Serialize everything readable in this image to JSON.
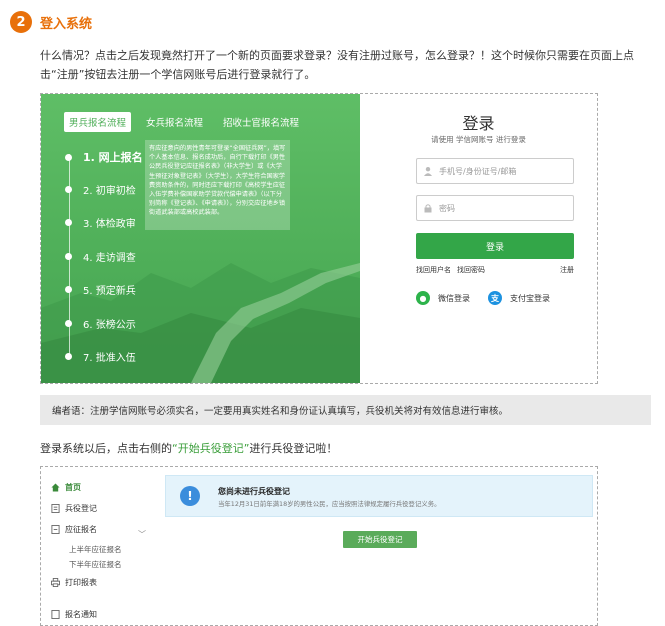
{
  "section": {
    "number": "2",
    "title": "登入系统"
  },
  "intro_text": "什么情况？点击之后发现竟然打开了一个新的页面要求登录？没有注册过账号，怎么登录？！这个时候你只需要在页面上点击“注册”按钮去注册一个学信网账号后进行登录就行了。",
  "screenshot1": {
    "tabs": [
      "男兵报名流程",
      "女兵报名流程",
      "招收士官报名流程"
    ],
    "steps": [
      "1. 网上报名",
      "2. 初审初检",
      "3. 体检政审",
      "4. 走访调查",
      "5. 预定新兵",
      "6. 张榜公示",
      "7. 批准入伍"
    ],
    "info_text": "有应征意向的男性青年可登录“全国征兵网”，填写个人基本信息、报名成功后，自行下载打印《男性公民兵役登记应征报名表》（非大学生）或《大学生预征对象登记表》（大学生），大学生符合国家学费资助条件的，同时还应下载打印《高校学生应征入伍学费补偿国家助学贷款代偿申请表》（以下分别简称《登记表》、《申请表》），分别交应征地乡镇街道武装部或高校武装部。",
    "login": {
      "title": "登录",
      "subtitle": "请使用 学信网账号 进行登录",
      "username_placeholder": "手机号/身份证号/邮箱",
      "password_placeholder": "密码",
      "login_button": "登录",
      "forgot_username": "找回用户名",
      "forgot_password": "找回密码",
      "register": "注册",
      "wechat_login": "微信登录",
      "alipay_login": "支付宝登录"
    }
  },
  "editor_note": "编者语：注册学信网账号必须实名，一定要用真实姓名和身份证认真填写，兵役机关将对有效信息进行审核。",
  "after_text": {
    "before": "登录系统以后，点击右侧的",
    "highlight": "“开始兵役登记”",
    "after": "进行兵役登记啦！"
  },
  "screenshot2": {
    "sidebar": {
      "home": "首页",
      "bingyi_register": "兵役登记",
      "enlist_apply": "应征报名",
      "first_half": "上半年应征报名",
      "second_half": "下半年应征报名",
      "print_report": "打印报表",
      "enlist_notice": "报名通知"
    },
    "alert_title": "您尚未进行兵役登记",
    "alert_desc": "当年12月31日前年满18岁的男性公民，应当按照法律规定履行兵役登记义务。",
    "start_button": "开始兵役登记"
  },
  "colors": {
    "accent_orange": "#e8700a",
    "green": "#4eae58",
    "login_green": "#33a648",
    "link_green": "#3a9e3a"
  }
}
